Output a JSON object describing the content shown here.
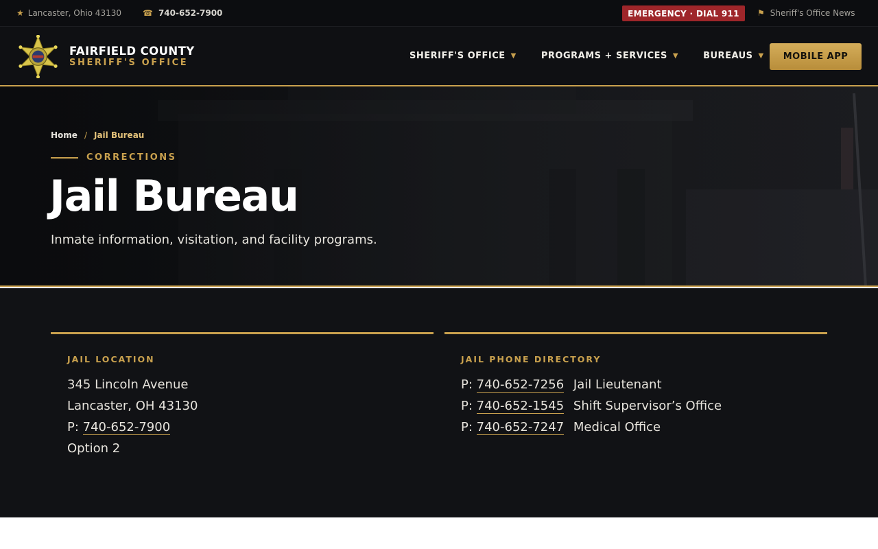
{
  "topbar": {
    "location": "Lancaster, Ohio 43130",
    "phone": "740-652-7900",
    "emergency": "EMERGENCY · DIAL 911",
    "news": "Sheriff's Office News"
  },
  "brand": {
    "line1": "FAIRFIELD COUNTY",
    "line2": "SHERIFF'S OFFICE"
  },
  "nav": {
    "items": [
      {
        "label": "SHERIFF'S OFFICE"
      },
      {
        "label": "PROGRAMS + SERVICES"
      },
      {
        "label": "BUREAUS"
      }
    ],
    "cta": "MOBILE APP"
  },
  "hero": {
    "breadcrumb": {
      "home": "Home",
      "separator": "/",
      "current": "Jail Bureau"
    },
    "eyebrow": "CORRECTIONS",
    "title": "Jail Bureau",
    "subtitle": "Inmate information, visitation, and facility programs."
  },
  "location_card": {
    "heading": "JAIL LOCATION",
    "street": "345 Lincoln Avenue",
    "city": "Lancaster, OH 43130",
    "phone_prefix": "P:",
    "phone": "740-652-7900",
    "option": "Option 2"
  },
  "directory_card": {
    "heading": "JAIL PHONE DIRECTORY",
    "entries": [
      {
        "prefix": "P:",
        "phone": "740-652-7256",
        "label": "Jail Lieutenant"
      },
      {
        "prefix": "P:",
        "phone": "740-652-1545",
        "label": "Shift Supervisor’s Office"
      },
      {
        "prefix": "P:",
        "phone": "740-652-7247",
        "label": "Medical Office"
      }
    ]
  },
  "colors": {
    "accent_gold": "#c9a14e",
    "emergency_red": "#9e262a",
    "background_dark": "#111215"
  },
  "icons": {
    "location": "star-icon",
    "phone": "phone-icon",
    "news": "flag-icon",
    "badge": "sheriff-star-badge-icon",
    "nav_caret": "caret-down-icon"
  }
}
